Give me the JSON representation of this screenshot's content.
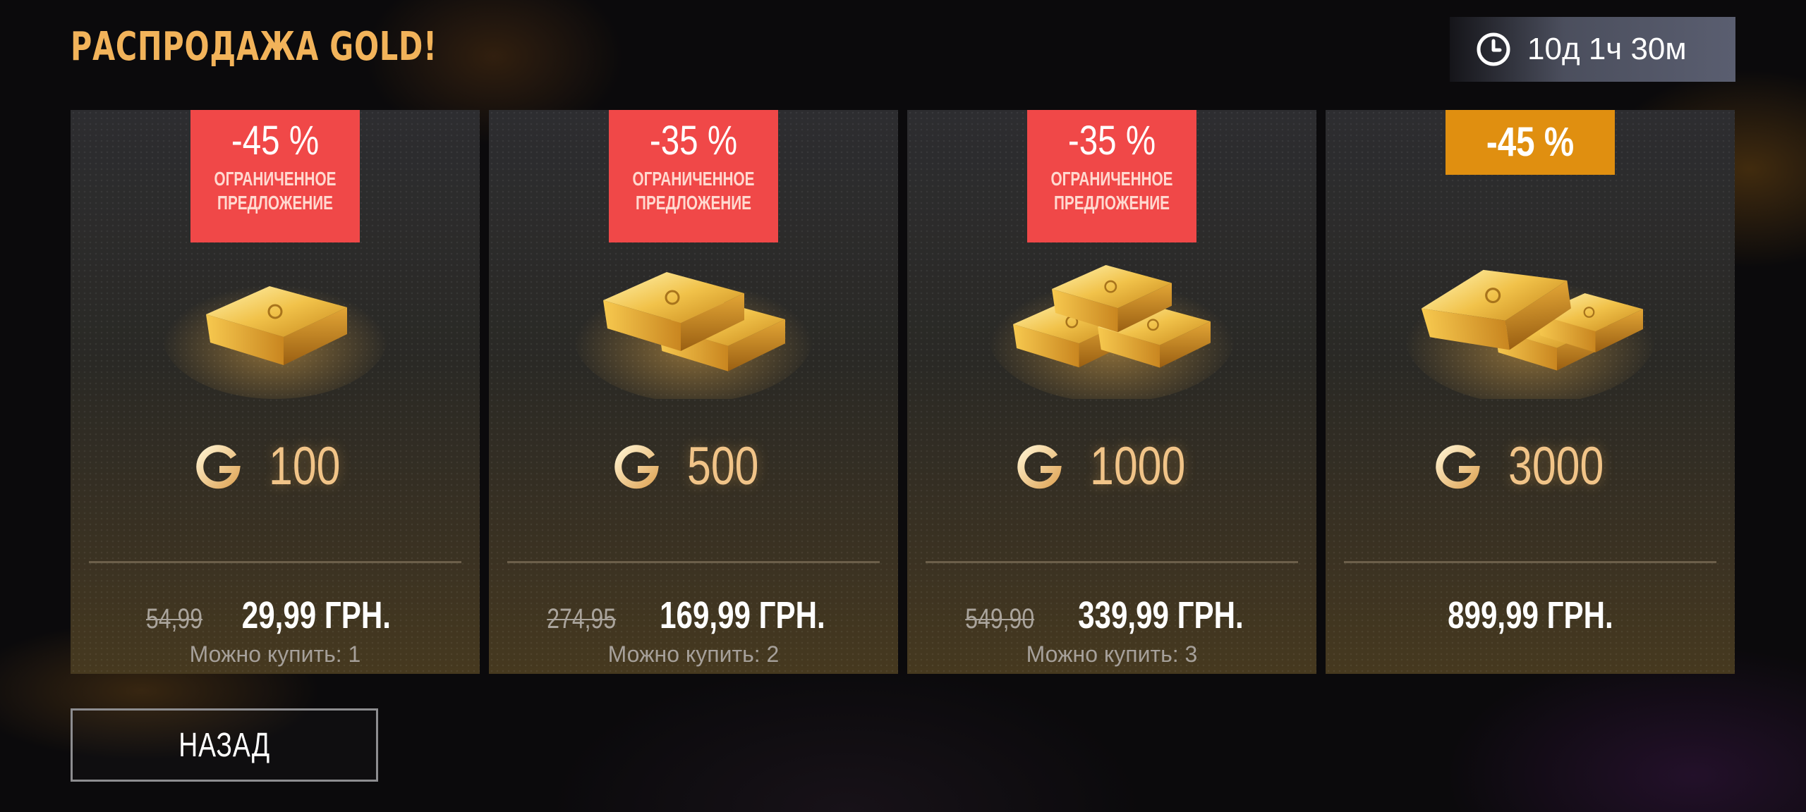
{
  "header": {
    "title": "РАСПРОДАЖА GOLD!",
    "timer_icon": "clock-icon",
    "timer_text": "10д 1ч 30м"
  },
  "colors": {
    "title": "#f2b35a",
    "badge_limited": "#f04848",
    "badge_plain": "#e08f10",
    "amount": "#f1c488"
  },
  "offers": [
    {
      "discount": "-45 %",
      "badge_text": "ОГРАНИЧЕННОЕ\nПРЕДЛОЖЕНИЕ",
      "image": "gold-bar-single",
      "currency_icon": "gold-g-icon",
      "amount": "100",
      "old_price": "54,99",
      "price": "29,99 ГРН.",
      "limit": "Можно купить: 1"
    },
    {
      "discount": "-35 %",
      "badge_text": "ОГРАНИЧЕННОЕ\nПРЕДЛОЖЕНИЕ",
      "image": "gold-bars-two",
      "currency_icon": "gold-g-icon",
      "amount": "500",
      "old_price": "274,95",
      "price": "169,99 ГРН.",
      "limit": "Можно купить: 2"
    },
    {
      "discount": "-35 %",
      "badge_text": "ОГРАНИЧЕННОЕ\nПРЕДЛОЖЕНИЕ",
      "image": "gold-bars-stack",
      "currency_icon": "gold-g-icon",
      "amount": "1000",
      "old_price": "549,90",
      "price": "339,99 ГРН.",
      "limit": "Можно купить: 3"
    },
    {
      "discount": "-45 %",
      "image": "gold-bars-pile",
      "currency_icon": "gold-g-icon",
      "amount": "3000",
      "price": "899,99 ГРН."
    }
  ],
  "footer": {
    "back_label": "НАЗАД"
  }
}
